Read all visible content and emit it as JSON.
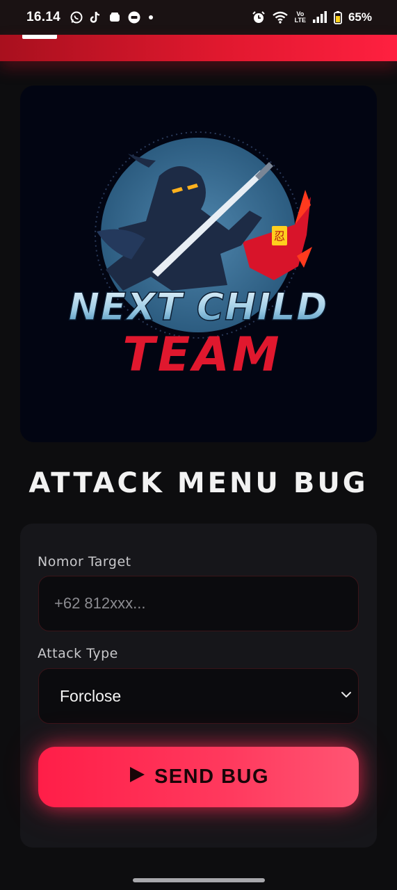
{
  "status_bar": {
    "time": "16.14",
    "battery_percent": "65%",
    "icons_left": [
      "whatsapp-icon",
      "tiktok-icon",
      "wallet-icon",
      "chat-icon",
      "dot-icon"
    ],
    "icons_right": [
      "alarm-icon",
      "wifi-icon",
      "volte-icon",
      "signal-icon",
      "battery-icon"
    ],
    "volte_top": "Vo",
    "volte_bottom": "LTE"
  },
  "header": {
    "accent_color": "#e0182e"
  },
  "logo": {
    "line1": "NEXT CHILD",
    "line2": "TEAM",
    "kanji": "忍"
  },
  "page": {
    "title": "ATTACK MENU BUG"
  },
  "form": {
    "target_label": "Nomor Target",
    "target_placeholder": "+62 812xxx...",
    "target_value": "",
    "attack_type_label": "Attack Type",
    "attack_type_selected": "Forclose",
    "send_button_label": "SEND BUG",
    "send_button_icon": "play-icon",
    "button_color": "#ff2a52"
  }
}
